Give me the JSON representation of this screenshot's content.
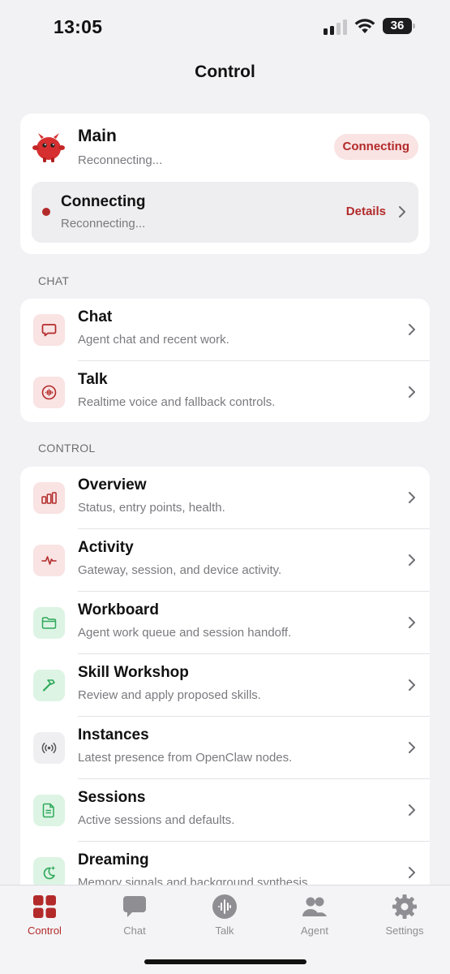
{
  "status_bar": {
    "time": "13:05",
    "battery": "36"
  },
  "page": {
    "title": "Control"
  },
  "main_card": {
    "title": "Main",
    "subtitle": "Reconnecting...",
    "status_pill": "Connecting",
    "connection": {
      "title": "Connecting",
      "subtitle": "Reconnecting...",
      "details_label": "Details"
    }
  },
  "sections": {
    "chat_label": "CHAT",
    "control_label": "CONTROL"
  },
  "chat_items": [
    {
      "title": "Chat",
      "subtitle": "Agent chat and recent work.",
      "icon": "chat-bubble-icon"
    },
    {
      "title": "Talk",
      "subtitle": "Realtime voice and fallback controls.",
      "icon": "voice-wave-icon"
    }
  ],
  "control_items": [
    {
      "title": "Overview",
      "subtitle": "Status, entry points, health.",
      "icon": "bar-chart-icon"
    },
    {
      "title": "Activity",
      "subtitle": "Gateway, session, and device activity.",
      "icon": "pulse-icon"
    },
    {
      "title": "Workboard",
      "subtitle": "Agent work queue and session handoff.",
      "icon": "folder-icon"
    },
    {
      "title": "Skill Workshop",
      "subtitle": "Review and apply proposed skills.",
      "icon": "hammer-icon"
    },
    {
      "title": "Instances",
      "subtitle": "Latest presence from OpenClaw nodes.",
      "icon": "broadcast-icon"
    },
    {
      "title": "Sessions",
      "subtitle": "Active sessions and defaults.",
      "icon": "document-icon"
    },
    {
      "title": "Dreaming",
      "subtitle": "Memory signals and background synthesis.",
      "icon": "moon-sparkle-icon"
    }
  ],
  "tabs": [
    {
      "label": "Control",
      "icon": "grid-icon",
      "active": true
    },
    {
      "label": "Chat",
      "icon": "chat-bubble-icon",
      "active": false
    },
    {
      "label": "Talk",
      "icon": "voice-wave-icon",
      "active": false
    },
    {
      "label": "Agent",
      "icon": "people-icon",
      "active": false
    },
    {
      "label": "Settings",
      "icon": "gear-icon",
      "active": false
    }
  ],
  "colors": {
    "accent": "#b32a2a",
    "green": "#2fa85a",
    "background": "#f2f2f4"
  }
}
